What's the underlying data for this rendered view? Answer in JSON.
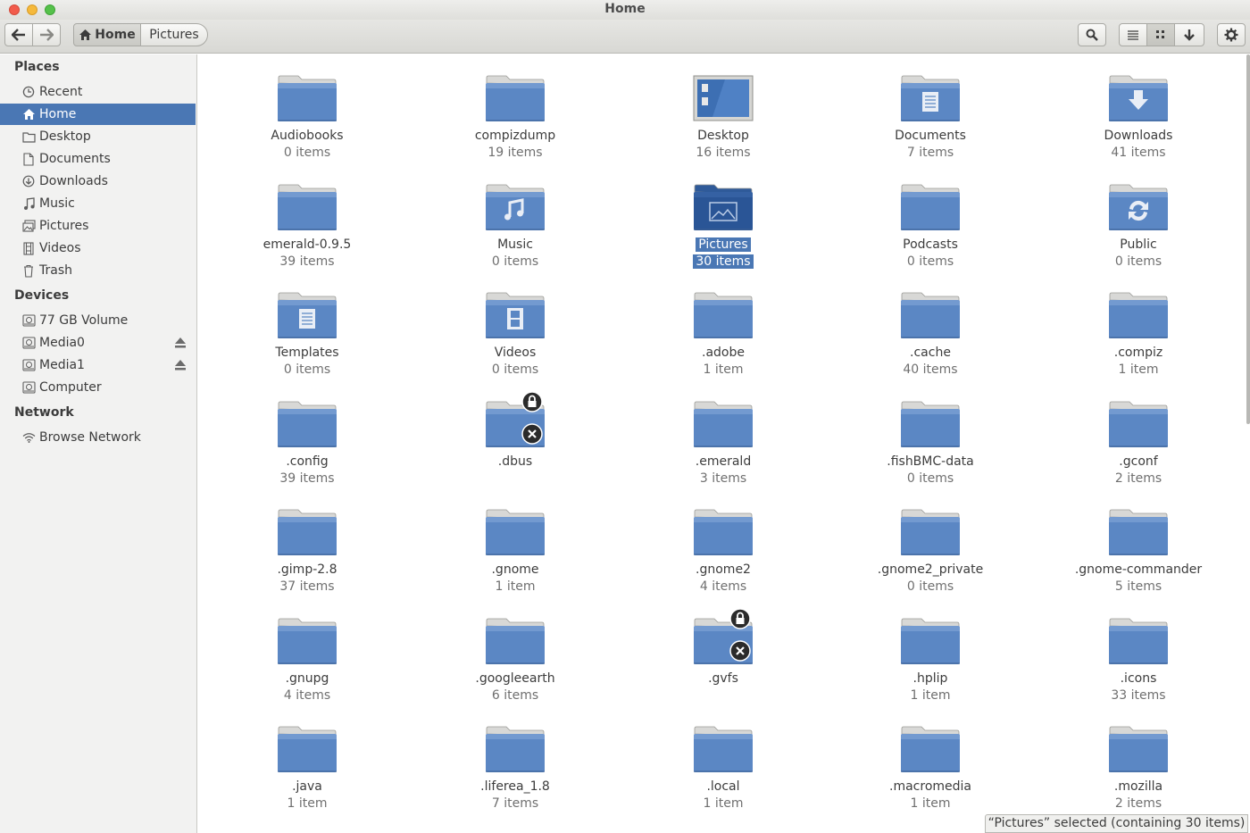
{
  "window": {
    "title": "Home"
  },
  "toolbar": {
    "breadcrumbs": [
      "Home",
      "Pictures"
    ]
  },
  "sidebar": {
    "places_title": "Places",
    "places": [
      {
        "label": "Recent",
        "icon": "clock-icon"
      },
      {
        "label": "Home",
        "icon": "home-icon",
        "selected": true
      },
      {
        "label": "Desktop",
        "icon": "desktop-folder-icon"
      },
      {
        "label": "Documents",
        "icon": "document-icon"
      },
      {
        "label": "Downloads",
        "icon": "download-icon"
      },
      {
        "label": "Music",
        "icon": "music-note-icon"
      },
      {
        "label": "Pictures",
        "icon": "picture-icon"
      },
      {
        "label": "Videos",
        "icon": "film-icon"
      },
      {
        "label": "Trash",
        "icon": "trash-icon"
      }
    ],
    "devices_title": "Devices",
    "devices": [
      {
        "label": "77 GB Volume",
        "icon": "drive-icon",
        "eject": false
      },
      {
        "label": "Media0",
        "icon": "drive-icon",
        "eject": true
      },
      {
        "label": "Media1",
        "icon": "drive-icon",
        "eject": true
      },
      {
        "label": "Computer",
        "icon": "drive-icon",
        "eject": false
      }
    ],
    "network_title": "Network",
    "network": [
      {
        "label": "Browse Network",
        "icon": "wifi-icon"
      }
    ]
  },
  "files": [
    {
      "name": "Audiobooks",
      "count": "0 items",
      "emblem": "none"
    },
    {
      "name": "compizdump",
      "count": "19 items",
      "emblem": "none"
    },
    {
      "name": "Desktop",
      "count": "16 items",
      "emblem": "desktop"
    },
    {
      "name": "Documents",
      "count": "7 items",
      "emblem": "document"
    },
    {
      "name": "Downloads",
      "count": "41 items",
      "emblem": "download"
    },
    {
      "name": "emerald-0.9.5",
      "count": "39 items",
      "emblem": "none"
    },
    {
      "name": "Music",
      "count": "0 items",
      "emblem": "music"
    },
    {
      "name": "Pictures",
      "count": "30 items",
      "emblem": "picture",
      "selected": true
    },
    {
      "name": "Podcasts",
      "count": "0 items",
      "emblem": "none"
    },
    {
      "name": "Public",
      "count": "0 items",
      "emblem": "share"
    },
    {
      "name": "Templates",
      "count": "0 items",
      "emblem": "document"
    },
    {
      "name": "Videos",
      "count": "0 items",
      "emblem": "film"
    },
    {
      "name": ".adobe",
      "count": "1 item",
      "emblem": "none"
    },
    {
      "name": ".cache",
      "count": "40 items",
      "emblem": "none"
    },
    {
      "name": ".compiz",
      "count": "1 item",
      "emblem": "none"
    },
    {
      "name": ".config",
      "count": "39 items",
      "emblem": "none"
    },
    {
      "name": ".dbus",
      "count": "",
      "emblem": "locked"
    },
    {
      "name": ".emerald",
      "count": "3 items",
      "emblem": "none"
    },
    {
      "name": ".fishBMC-data",
      "count": "0 items",
      "emblem": "none"
    },
    {
      "name": ".gconf",
      "count": "2 items",
      "emblem": "none"
    },
    {
      "name": ".gimp-2.8",
      "count": "37 items",
      "emblem": "none"
    },
    {
      "name": ".gnome",
      "count": "1 item",
      "emblem": "none"
    },
    {
      "name": ".gnome2",
      "count": "4 items",
      "emblem": "none"
    },
    {
      "name": ".gnome2_private",
      "count": "0 items",
      "emblem": "none"
    },
    {
      "name": ".gnome-commander",
      "count": "5 items",
      "emblem": "none"
    },
    {
      "name": ".gnupg",
      "count": "4 items",
      "emblem": "none"
    },
    {
      "name": ".googleearth",
      "count": "6 items",
      "emblem": "none"
    },
    {
      "name": ".gvfs",
      "count": "",
      "emblem": "locked"
    },
    {
      "name": ".hplip",
      "count": "1 item",
      "emblem": "none"
    },
    {
      "name": ".icons",
      "count": "33 items",
      "emblem": "none"
    },
    {
      "name": ".java",
      "count": "1 item",
      "emblem": "none"
    },
    {
      "name": ".liferea_1.8",
      "count": "7 items",
      "emblem": "none"
    },
    {
      "name": ".local",
      "count": "1 item",
      "emblem": "none"
    },
    {
      "name": ".macromedia",
      "count": "1 item",
      "emblem": "none"
    },
    {
      "name": ".mozilla",
      "count": "2 items",
      "emblem": "none"
    }
  ],
  "status": "“Pictures” selected  (containing 30 items)",
  "colors": {
    "selection": "#4a77b4",
    "folder": "#5b87c4",
    "folder_selected": "#2a5596"
  }
}
